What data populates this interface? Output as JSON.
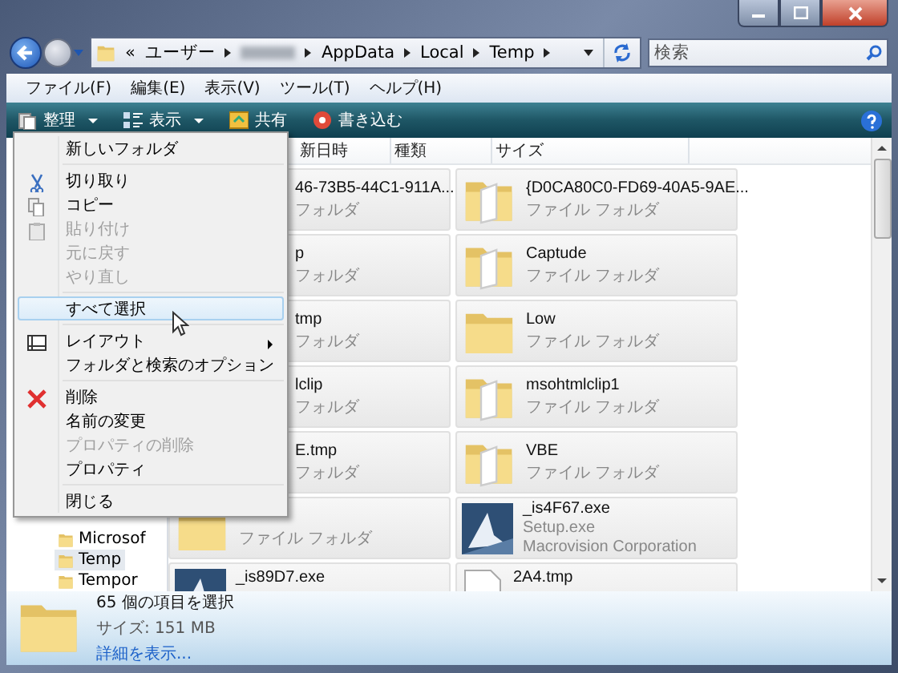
{
  "address": {
    "segments": [
      {
        "kind": "text",
        "label": "«"
      },
      {
        "kind": "text",
        "label": "ユーザー"
      },
      {
        "kind": "blurred"
      },
      {
        "kind": "text",
        "label": "AppData"
      },
      {
        "kind": "text",
        "label": "Local"
      },
      {
        "kind": "text",
        "label": "Temp"
      }
    ]
  },
  "search": {
    "placeholder": "検索"
  },
  "menu_bar": [
    "ファイル(F)",
    "編集(E)",
    "表示(V)",
    "ツール(T)",
    "ヘルプ(H)"
  ],
  "toolbar": [
    {
      "kind": "organize",
      "label": "整理",
      "caret": true
    },
    {
      "kind": "views",
      "label": "表示",
      "caret": true
    },
    {
      "kind": "share",
      "label": "共有",
      "caret": false
    },
    {
      "kind": "burn",
      "label": "書き込む",
      "caret": false
    }
  ],
  "columns": [
    "新日時",
    "種類",
    "サイズ"
  ],
  "nav_items": [
    {
      "label": "Microsof",
      "selected": false
    },
    {
      "label": "Temp",
      "selected": true
    },
    {
      "label": "Tempor",
      "selected": false
    }
  ],
  "tiles": [
    [
      {
        "kind": "covered",
        "name": "46-73B5-44C1-911A...",
        "lines": [
          "フォルダ"
        ]
      },
      {
        "kind": "folder-open",
        "name": "{D0CA80C0-FD69-40A5-9AE...",
        "lines": [
          "ファイル フォルダ"
        ]
      }
    ],
    [
      {
        "kind": "covered",
        "name": "p",
        "lines": [
          "フォルダ"
        ]
      },
      {
        "kind": "folder-open",
        "name": "Captude",
        "lines": [
          "ファイル フォルダ"
        ]
      }
    ],
    [
      {
        "kind": "covered",
        "name": "tmp",
        "lines": [
          "フォルダ"
        ]
      },
      {
        "kind": "folder",
        "name": "Low",
        "lines": [
          "ファイル フォルダ"
        ]
      }
    ],
    [
      {
        "kind": "covered",
        "name": "lclip",
        "lines": [
          "フォルダ"
        ]
      },
      {
        "kind": "folder-open",
        "name": "msohtmlclip1",
        "lines": [
          "ファイル フォルダ"
        ]
      }
    ],
    [
      {
        "kind": "covered",
        "name": "E.tmp",
        "lines": [
          "フォルダ"
        ]
      },
      {
        "kind": "folder-open",
        "name": "VBE",
        "lines": [
          "ファイル フォルダ"
        ]
      }
    ],
    [
      {
        "kind": "folder",
        "lines": [
          "ファイル フォルダ"
        ]
      },
      {
        "kind": "exe",
        "name": "_is4F67.exe",
        "lines": [
          "Setup.exe",
          "Macrovision Corporation"
        ]
      }
    ],
    [
      {
        "kind": "exe",
        "name": "_is89D7.exe"
      },
      {
        "kind": "file",
        "name": "2A4.tmp"
      }
    ]
  ],
  "context_menu": [
    {
      "kind": "item",
      "label": "新しいフォルダ",
      "disabled": false,
      "selected": false
    },
    {
      "kind": "separator"
    },
    {
      "kind": "cut",
      "label": "切り取り",
      "disabled": false,
      "selected": false
    },
    {
      "kind": "copy",
      "label": "コピー",
      "disabled": false,
      "selected": false
    },
    {
      "kind": "paste",
      "label": "貼り付け",
      "disabled": true,
      "selected": false
    },
    {
      "kind": "item",
      "label": "元に戻す",
      "disabled": true,
      "selected": false
    },
    {
      "kind": "item",
      "label": "やり直し",
      "disabled": true,
      "selected": false
    },
    {
      "kind": "separator"
    },
    {
      "kind": "item",
      "label": "すべて選択",
      "disabled": false,
      "selected": true
    },
    {
      "kind": "separator"
    },
    {
      "kind": "layout",
      "label": "レイアウト",
      "disabled": false,
      "selected": false
    },
    {
      "kind": "item",
      "label": "フォルダと検索のオプション",
      "disabled": false,
      "selected": false
    },
    {
      "kind": "separator"
    },
    {
      "kind": "delete",
      "label": "削除",
      "disabled": false,
      "selected": false
    },
    {
      "kind": "item",
      "label": "名前の変更",
      "disabled": false,
      "selected": false
    },
    {
      "kind": "item",
      "label": "プロパティの削除",
      "disabled": true,
      "selected": false
    },
    {
      "kind": "item",
      "label": "プロパティ",
      "disabled": false,
      "selected": false
    },
    {
      "kind": "separator"
    },
    {
      "kind": "item",
      "label": "閉じる",
      "disabled": false,
      "selected": false
    }
  ],
  "details": {
    "title": "65 個の項目を選択",
    "size": "サイズ: 151 MB",
    "link": "詳細を表示..."
  }
}
